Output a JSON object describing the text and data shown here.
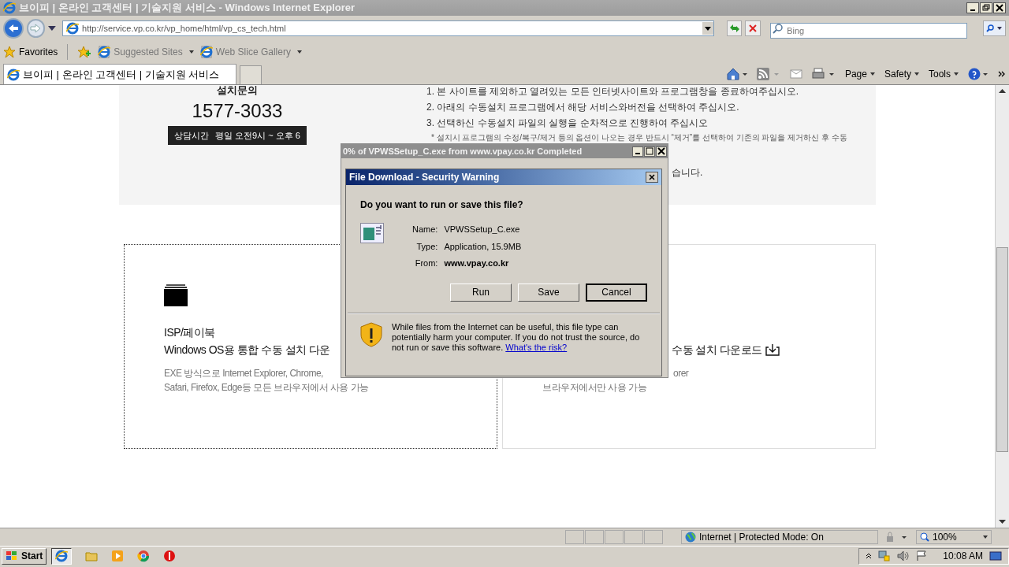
{
  "window": {
    "title": "브이피 | 온라인 고객센터 | 기술지원 서비스 - Windows Internet Explorer"
  },
  "address_bar": {
    "url": "http://service.vp.co.kr/vp_home/html/vp_cs_tech.html"
  },
  "search": {
    "placeholder": "Bing"
  },
  "favorites_bar": {
    "label": "Favorites",
    "items": [
      "Suggested Sites",
      "Web Slice Gallery"
    ]
  },
  "tabs": [
    {
      "label": "브이피 | 온라인 고객센터 | 기술지원 서비스",
      "selected": true
    }
  ],
  "command_bar": [
    "Page",
    "Safety",
    "Tools"
  ],
  "page": {
    "contact_title": "설치문의",
    "phone": "1577-3033",
    "hours_label": "상담시간",
    "hours": "평일 오전9시 ~ 오후 6",
    "steps": [
      "1. 본 사이트를 제외하고 열려있는 모든 인터넷사이트와 프로그램창을 종료하여주십시오.",
      "2. 아래의 수동설치 프로그램에서 해당 서비스와버전을 선택하여 주십시오.",
      "3. 선택하신 수동설치 파일의 실행을 순차적으로 진행하여 주십시오"
    ],
    "note": "* 설치시 프로그램의 수정/복구/제거 등의 옵션이 나오는 경우 반드시 “제거”를 선택하여 기존의 파일을 제거하신 후 수동",
    "note_tail": "습니다.",
    "cards": [
      {
        "focused": true,
        "title": "ISP/페이북",
        "subtitle": "Windows OS용 통합 수동 설치 다운",
        "lines": [
          "EXE 방식으로 Internet Explorer, Chrome,",
          "Safari, Firefox, Edge등 모든 브라우저에서 사용 가능"
        ]
      },
      {
        "focused": false,
        "subtitle": "수동 설치 다운로드",
        "lines": [
          "orer",
          "브라우저에서만 사용 가능"
        ]
      }
    ]
  },
  "download_window": {
    "title": "0% of VPWSSetup_C.exe from www.vpay.co.kr Completed"
  },
  "dialog": {
    "title": "File Download - Security Warning",
    "question": "Do you want to run or save this file?",
    "fields": [
      {
        "label": "Name:",
        "value": "VPWSSetup_C.exe",
        "bold": false
      },
      {
        "label": "Type:",
        "value": "Application, 15.9MB",
        "bold": false
      },
      {
        "label": "From:",
        "value": "www.vpay.co.kr",
        "bold": true
      }
    ],
    "buttons": [
      {
        "label": "Run",
        "default": false
      },
      {
        "label": "Save",
        "default": false
      },
      {
        "label": "Cancel",
        "default": true
      }
    ],
    "warning": "While files from the Internet can be useful, this file type can potentially harm your computer. If you do not trust the source, do not run or save this software.",
    "link": "What's the risk?"
  },
  "status_bar": {
    "zone": "Internet | Protected Mode: On",
    "zoom": "100%"
  },
  "taskbar": {
    "start": "Start",
    "clock": "10:08 AM"
  }
}
